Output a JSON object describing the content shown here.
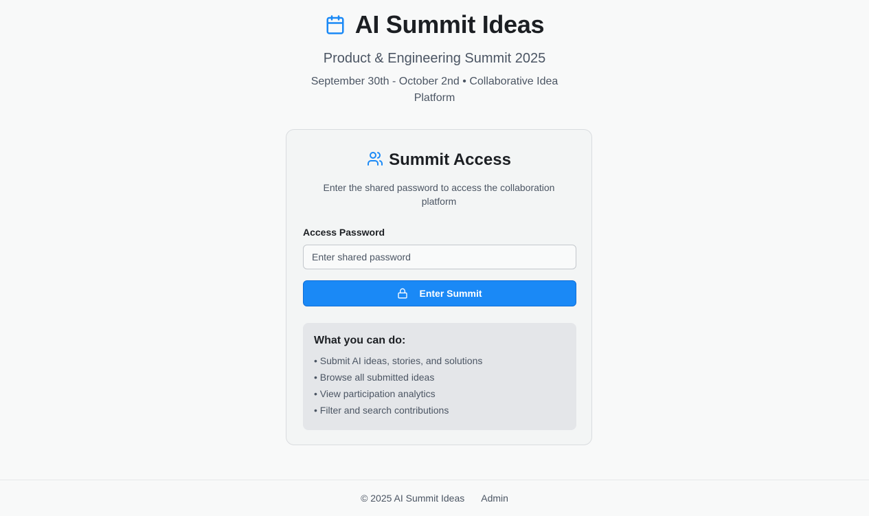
{
  "header": {
    "icon": "calendar-icon",
    "title": "AI Summit Ideas",
    "subtitle": "Product & Engineering Summit 2025",
    "dates": "September 30th - October 2nd • Collaborative Idea Platform"
  },
  "card": {
    "icon": "users-icon",
    "title": "Summit Access",
    "description": "Enter the shared password to access the collaboration platform",
    "password_label": "Access Password",
    "password_placeholder": "Enter shared password",
    "password_value": "",
    "button_icon": "lock-icon",
    "button_label": "Enter Summit",
    "info": {
      "title": "What you can do:",
      "items": [
        "• Submit AI ideas, stories, and solutions",
        "• Browse all submitted ideas",
        "• View participation analytics",
        "• Filter and search contributions"
      ]
    }
  },
  "footer": {
    "copyright": "© 2025 AI Summit Ideas",
    "admin_link": "Admin"
  },
  "colors": {
    "accent": "#1a89f6",
    "background": "#f8f9f9",
    "card_background": "#f3f5f5",
    "info_background": "#e4e6e9",
    "text_primary": "#1c1f23",
    "text_secondary": "#4b5563"
  }
}
